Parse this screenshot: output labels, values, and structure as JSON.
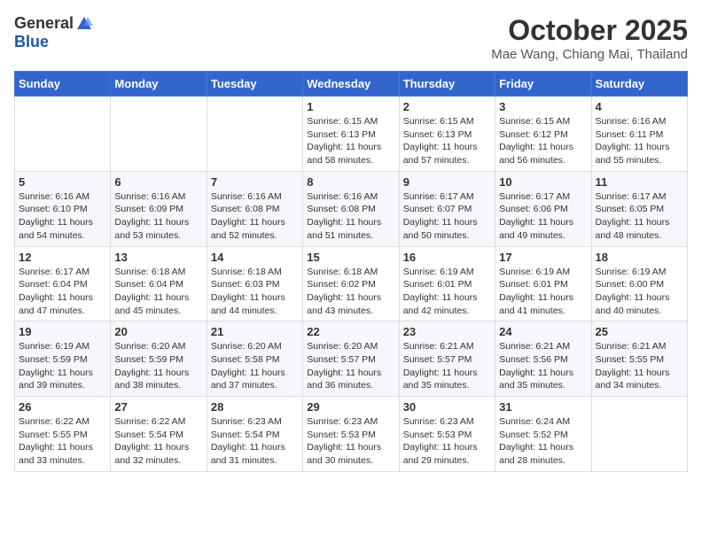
{
  "header": {
    "logo_general": "General",
    "logo_blue": "Blue",
    "month": "October 2025",
    "location": "Mae Wang, Chiang Mai, Thailand"
  },
  "days_of_week": [
    "Sunday",
    "Monday",
    "Tuesday",
    "Wednesday",
    "Thursday",
    "Friday",
    "Saturday"
  ],
  "weeks": [
    [
      {
        "day": "",
        "info": ""
      },
      {
        "day": "",
        "info": ""
      },
      {
        "day": "",
        "info": ""
      },
      {
        "day": "1",
        "info": "Sunrise: 6:15 AM\nSunset: 6:13 PM\nDaylight: 11 hours\nand 58 minutes."
      },
      {
        "day": "2",
        "info": "Sunrise: 6:15 AM\nSunset: 6:13 PM\nDaylight: 11 hours\nand 57 minutes."
      },
      {
        "day": "3",
        "info": "Sunrise: 6:15 AM\nSunset: 6:12 PM\nDaylight: 11 hours\nand 56 minutes."
      },
      {
        "day": "4",
        "info": "Sunrise: 6:16 AM\nSunset: 6:11 PM\nDaylight: 11 hours\nand 55 minutes."
      }
    ],
    [
      {
        "day": "5",
        "info": "Sunrise: 6:16 AM\nSunset: 6:10 PM\nDaylight: 11 hours\nand 54 minutes."
      },
      {
        "day": "6",
        "info": "Sunrise: 6:16 AM\nSunset: 6:09 PM\nDaylight: 11 hours\nand 53 minutes."
      },
      {
        "day": "7",
        "info": "Sunrise: 6:16 AM\nSunset: 6:08 PM\nDaylight: 11 hours\nand 52 minutes."
      },
      {
        "day": "8",
        "info": "Sunrise: 6:16 AM\nSunset: 6:08 PM\nDaylight: 11 hours\nand 51 minutes."
      },
      {
        "day": "9",
        "info": "Sunrise: 6:17 AM\nSunset: 6:07 PM\nDaylight: 11 hours\nand 50 minutes."
      },
      {
        "day": "10",
        "info": "Sunrise: 6:17 AM\nSunset: 6:06 PM\nDaylight: 11 hours\nand 49 minutes."
      },
      {
        "day": "11",
        "info": "Sunrise: 6:17 AM\nSunset: 6:05 PM\nDaylight: 11 hours\nand 48 minutes."
      }
    ],
    [
      {
        "day": "12",
        "info": "Sunrise: 6:17 AM\nSunset: 6:04 PM\nDaylight: 11 hours\nand 47 minutes."
      },
      {
        "day": "13",
        "info": "Sunrise: 6:18 AM\nSunset: 6:04 PM\nDaylight: 11 hours\nand 45 minutes."
      },
      {
        "day": "14",
        "info": "Sunrise: 6:18 AM\nSunset: 6:03 PM\nDaylight: 11 hours\nand 44 minutes."
      },
      {
        "day": "15",
        "info": "Sunrise: 6:18 AM\nSunset: 6:02 PM\nDaylight: 11 hours\nand 43 minutes."
      },
      {
        "day": "16",
        "info": "Sunrise: 6:19 AM\nSunset: 6:01 PM\nDaylight: 11 hours\nand 42 minutes."
      },
      {
        "day": "17",
        "info": "Sunrise: 6:19 AM\nSunset: 6:01 PM\nDaylight: 11 hours\nand 41 minutes."
      },
      {
        "day": "18",
        "info": "Sunrise: 6:19 AM\nSunset: 6:00 PM\nDaylight: 11 hours\nand 40 minutes."
      }
    ],
    [
      {
        "day": "19",
        "info": "Sunrise: 6:19 AM\nSunset: 5:59 PM\nDaylight: 11 hours\nand 39 minutes."
      },
      {
        "day": "20",
        "info": "Sunrise: 6:20 AM\nSunset: 5:59 PM\nDaylight: 11 hours\nand 38 minutes."
      },
      {
        "day": "21",
        "info": "Sunrise: 6:20 AM\nSunset: 5:58 PM\nDaylight: 11 hours\nand 37 minutes."
      },
      {
        "day": "22",
        "info": "Sunrise: 6:20 AM\nSunset: 5:57 PM\nDaylight: 11 hours\nand 36 minutes."
      },
      {
        "day": "23",
        "info": "Sunrise: 6:21 AM\nSunset: 5:57 PM\nDaylight: 11 hours\nand 35 minutes."
      },
      {
        "day": "24",
        "info": "Sunrise: 6:21 AM\nSunset: 5:56 PM\nDaylight: 11 hours\nand 35 minutes."
      },
      {
        "day": "25",
        "info": "Sunrise: 6:21 AM\nSunset: 5:55 PM\nDaylight: 11 hours\nand 34 minutes."
      }
    ],
    [
      {
        "day": "26",
        "info": "Sunrise: 6:22 AM\nSunset: 5:55 PM\nDaylight: 11 hours\nand 33 minutes."
      },
      {
        "day": "27",
        "info": "Sunrise: 6:22 AM\nSunset: 5:54 PM\nDaylight: 11 hours\nand 32 minutes."
      },
      {
        "day": "28",
        "info": "Sunrise: 6:23 AM\nSunset: 5:54 PM\nDaylight: 11 hours\nand 31 minutes."
      },
      {
        "day": "29",
        "info": "Sunrise: 6:23 AM\nSunset: 5:53 PM\nDaylight: 11 hours\nand 30 minutes."
      },
      {
        "day": "30",
        "info": "Sunrise: 6:23 AM\nSunset: 5:53 PM\nDaylight: 11 hours\nand 29 minutes."
      },
      {
        "day": "31",
        "info": "Sunrise: 6:24 AM\nSunset: 5:52 PM\nDaylight: 11 hours\nand 28 minutes."
      },
      {
        "day": "",
        "info": ""
      }
    ]
  ]
}
